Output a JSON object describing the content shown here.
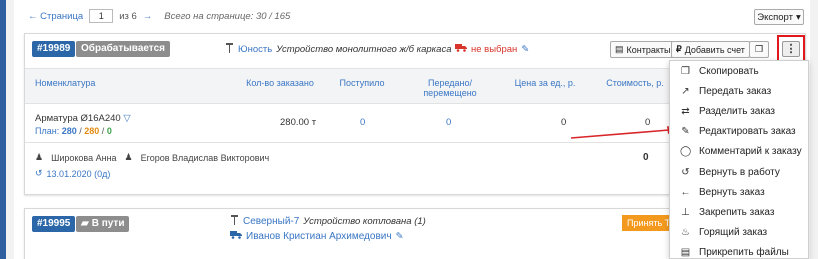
{
  "pager": {
    "prev": "← Страница",
    "page": "1",
    "of": "из 6",
    "next": "→",
    "total": "Всего на странице: 30 / 165"
  },
  "export": {
    "label": "Экспорт",
    "caret": "▾"
  },
  "order1": {
    "id": "#19989",
    "status": "Обрабатывается",
    "object_link": "Юность",
    "object_desc": "Устройство монолитного ж/б каркаса",
    "driver": "не выбран",
    "contracts_btn": "Контракты",
    "add_invoice_btn": "Добавить счет",
    "kebab": "⋮",
    "headers": {
      "nomenclature": "Номенклатура",
      "ordered": "Кол-во заказано",
      "received": "Поступило",
      "transferred": "Передано/ перемещено",
      "price": "Цена за ед., р.",
      "cost": "Стоимость, р."
    },
    "row": {
      "name": "Арматура Ø16А240",
      "plan_label": "План:",
      "plan_a": "280",
      "plan_b": "280",
      "plan_c": "0",
      "ordered": "280.00 т",
      "received": "0",
      "transferred": "0",
      "price": "0",
      "cost": "0"
    },
    "person1": "Широкова Анна",
    "person2": "Егоров Владислав Викторович",
    "date": "13.01.2020 (0д)",
    "total": "0"
  },
  "order2": {
    "id": "#19995",
    "status": "В пути",
    "object_link": "Северный-7",
    "object_desc": "Устройство котлована (1)",
    "person": "Иванов Кристиан Архимедович",
    "accept": "Принять ТН"
  },
  "menu": [
    {
      "icon": "copy-icon",
      "glyph": "❐",
      "label": "Скопировать"
    },
    {
      "icon": "transfer-icon",
      "glyph": "↗",
      "label": "Передать заказ"
    },
    {
      "icon": "split-icon",
      "glyph": "⇄",
      "label": "Разделить заказ"
    },
    {
      "icon": "pencil-icon",
      "glyph": "✎",
      "label": "Редактировать заказ"
    },
    {
      "icon": "comment-icon",
      "glyph": "◯",
      "label": "Комментарий к заказу"
    },
    {
      "icon": "undo-icon",
      "glyph": "↺",
      "label": "Вернуть в работу"
    },
    {
      "icon": "arrow-left-icon",
      "glyph": "←",
      "label": "Вернуть заказ"
    },
    {
      "icon": "pin-icon",
      "glyph": "⊥",
      "label": "Закрепить заказ"
    },
    {
      "icon": "fire-icon",
      "glyph": "♨",
      "label": "Горящий заказ"
    },
    {
      "icon": "file-icon",
      "glyph": "▤",
      "label": "Прикрепить файлы"
    }
  ],
  "colors": {
    "accent": "#2b67a8",
    "status_gray": "#8d8d8d",
    "danger": "#e0191e",
    "warning": "#f39a1e"
  }
}
